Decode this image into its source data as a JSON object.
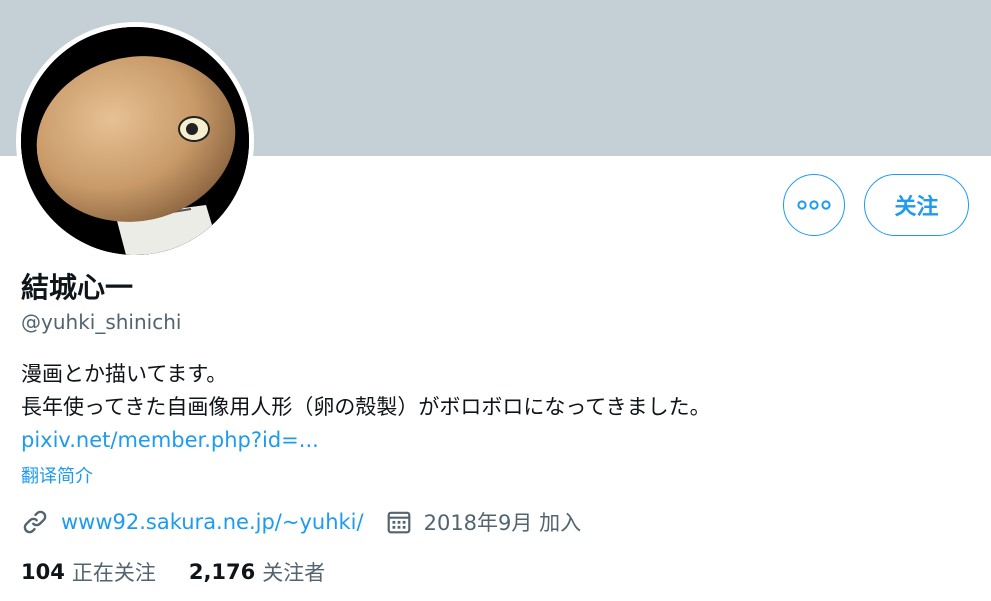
{
  "profile": {
    "display_name": "結城心一",
    "handle": "@yuhki_shinichi",
    "bio_lines": [
      "漫画とか描いてます。",
      "長年使ってきた自画像用人形（卵の殻製）がボロボロになってきました。"
    ],
    "bio_link": "pixiv.net/member.php?id=...",
    "translate_label": "翻译简介",
    "website": "www92.sakura.ne.jp/~yuhki/",
    "joined": "2018年9月 加入"
  },
  "actions": {
    "follow_label": "关注",
    "more_icon": "more-horizontal-icon"
  },
  "stats": {
    "following_count": "104",
    "following_label": "正在关注",
    "followers_count": "2,176",
    "followers_label": "关注者"
  },
  "colors": {
    "banner": "#c4cfd6",
    "accent": "#1d9bf0",
    "secondary_text": "#536471",
    "primary_text": "#0f1419"
  },
  "icons": {
    "website": "link-icon",
    "joined": "calendar-icon"
  }
}
